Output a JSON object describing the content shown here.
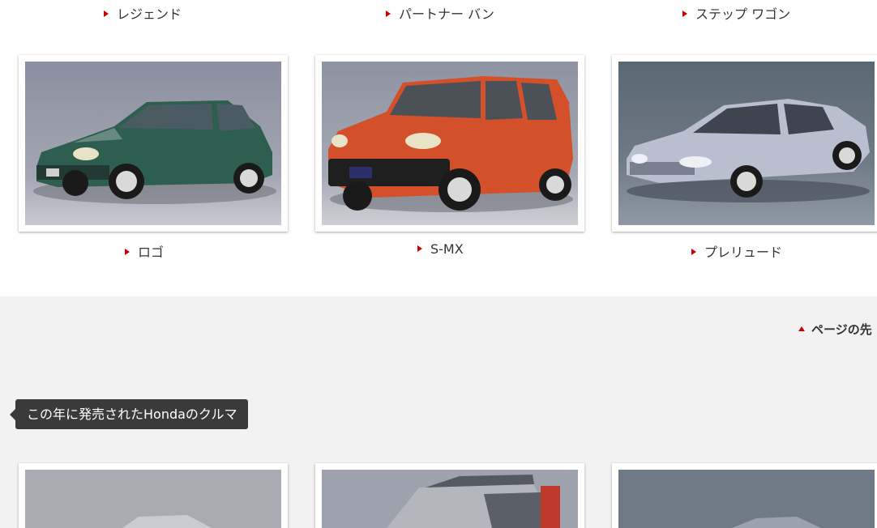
{
  "previous_row": {
    "labels": [
      "レジェンド",
      "パートナー バン",
      "ステップ ワゴン"
    ]
  },
  "cars": [
    {
      "label": "ロゴ",
      "body_color": "#2e5e4f",
      "bg_color": "#8a8f9c"
    },
    {
      "label": "S-MX",
      "body_color": "#d4502a",
      "bg_color": "#8d93a0"
    },
    {
      "label": "プレリュード",
      "body_color": "#b9bfcf",
      "bg_color": "#5d6a78"
    }
  ],
  "page_top": {
    "label": "ページの先"
  },
  "section": {
    "heading": "この年に発売されたHondaのクルマ"
  },
  "colors": {
    "accent": "#cc0000",
    "heading_bg": "#3a3a3a",
    "page_bg": "#f2f2f2"
  }
}
